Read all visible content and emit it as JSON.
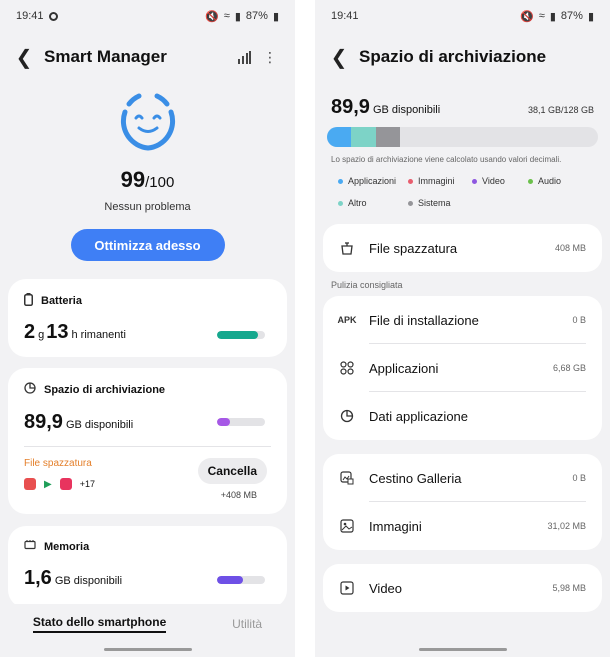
{
  "left": {
    "status": {
      "time": "19:41",
      "battery": "87%"
    },
    "header": {
      "title": "Smart Manager"
    },
    "score": {
      "value": "99",
      "max": "/100",
      "status": "Nessun problema"
    },
    "optimize_label": "Ottimizza adesso",
    "battery_card": {
      "title": "Batteria",
      "hours": "2",
      "h_unit": "g",
      "minutes": "13",
      "m_unit": "h rimanenti",
      "level": 0.85,
      "color": "#15a88e"
    },
    "storage_card": {
      "title": "Spazio di archiviazione",
      "value": "89,9",
      "unit": "GB disponibili",
      "level": 0.28,
      "color": "#a658e6",
      "junk_label": "File spazzatura",
      "apps_more": "+17",
      "cancel_label": "Cancella",
      "junk_size": "+408 MB"
    },
    "memory_card": {
      "title": "Memoria",
      "value": "1,6",
      "unit": "GB disponibili",
      "level": 0.55,
      "color": "#6e50e6"
    },
    "tabs": {
      "active": "Stato dello smartphone",
      "inactive": "Utilità"
    }
  },
  "right": {
    "status": {
      "time": "19:41",
      "battery": "87%"
    },
    "header": {
      "title": "Spazio di archiviazione"
    },
    "available": {
      "value": "89,9",
      "unit": "GB disponibili",
      "used": "38,1 GB/128 GB"
    },
    "usage_bar": [
      {
        "name": "Applicazioni",
        "color": "#4aaaf2",
        "fraction": 0.09
      },
      {
        "name": "Altro",
        "color": "#7dd3c7",
        "fraction": 0.09
      },
      {
        "name": "Sistema",
        "color": "#959599",
        "fraction": 0.09
      }
    ],
    "note": "Lo spazio di archiviazione viene calcolato usando valori decimali.",
    "legend": [
      {
        "label": "Applicazioni",
        "color": "#4aaaf2"
      },
      {
        "label": "Immagini",
        "color": "#e85d6e"
      },
      {
        "label": "Video",
        "color": "#8e57e0"
      },
      {
        "label": "Audio",
        "color": "#6bc04b"
      },
      {
        "label": "Altro",
        "color": "#7dd3c7"
      },
      {
        "label": "Sistema",
        "color": "#959599"
      }
    ],
    "junk": {
      "label": "File spazzatura",
      "value": "408 MB"
    },
    "recommended_title": "Pulizia consigliata",
    "apk_label": "APK",
    "recommended": [
      {
        "label": "File di installazione",
        "value": "0 B"
      },
      {
        "label": "Applicazioni",
        "value": "6,68 GB"
      },
      {
        "label": "Dati applicazione",
        "value": ""
      }
    ],
    "media": [
      {
        "label": "Cestino Galleria",
        "value": "0 B"
      },
      {
        "label": "Immagini",
        "value": "31,02 MB"
      }
    ],
    "video": {
      "label": "Video",
      "value": "5,98 MB"
    }
  }
}
